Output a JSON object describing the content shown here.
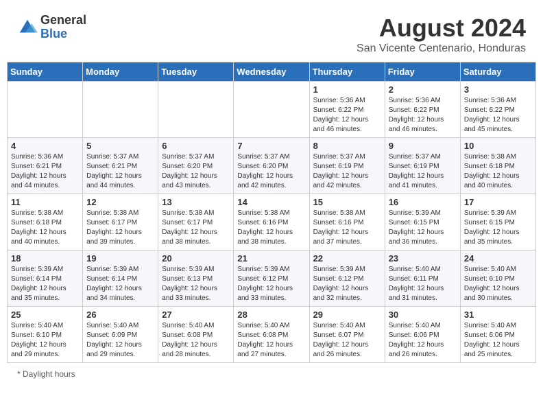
{
  "header": {
    "logo_general": "General",
    "logo_blue": "Blue",
    "month_title": "August 2024",
    "location": "San Vicente Centenario, Honduras"
  },
  "days_of_week": [
    "Sunday",
    "Monday",
    "Tuesday",
    "Wednesday",
    "Thursday",
    "Friday",
    "Saturday"
  ],
  "weeks": [
    [
      {
        "day": "",
        "info": ""
      },
      {
        "day": "",
        "info": ""
      },
      {
        "day": "",
        "info": ""
      },
      {
        "day": "",
        "info": ""
      },
      {
        "day": "1",
        "sunrise": "5:36 AM",
        "sunset": "6:22 PM",
        "daylight": "12 hours and 46 minutes."
      },
      {
        "day": "2",
        "sunrise": "5:36 AM",
        "sunset": "6:22 PM",
        "daylight": "12 hours and 46 minutes."
      },
      {
        "day": "3",
        "sunrise": "5:36 AM",
        "sunset": "6:22 PM",
        "daylight": "12 hours and 45 minutes."
      }
    ],
    [
      {
        "day": "4",
        "sunrise": "5:36 AM",
        "sunset": "6:21 PM",
        "daylight": "12 hours and 44 minutes."
      },
      {
        "day": "5",
        "sunrise": "5:37 AM",
        "sunset": "6:21 PM",
        "daylight": "12 hours and 44 minutes."
      },
      {
        "day": "6",
        "sunrise": "5:37 AM",
        "sunset": "6:20 PM",
        "daylight": "12 hours and 43 minutes."
      },
      {
        "day": "7",
        "sunrise": "5:37 AM",
        "sunset": "6:20 PM",
        "daylight": "12 hours and 42 minutes."
      },
      {
        "day": "8",
        "sunrise": "5:37 AM",
        "sunset": "6:19 PM",
        "daylight": "12 hours and 42 minutes."
      },
      {
        "day": "9",
        "sunrise": "5:37 AM",
        "sunset": "6:19 PM",
        "daylight": "12 hours and 41 minutes."
      },
      {
        "day": "10",
        "sunrise": "5:38 AM",
        "sunset": "6:18 PM",
        "daylight": "12 hours and 40 minutes."
      }
    ],
    [
      {
        "day": "11",
        "sunrise": "5:38 AM",
        "sunset": "6:18 PM",
        "daylight": "12 hours and 40 minutes."
      },
      {
        "day": "12",
        "sunrise": "5:38 AM",
        "sunset": "6:17 PM",
        "daylight": "12 hours and 39 minutes."
      },
      {
        "day": "13",
        "sunrise": "5:38 AM",
        "sunset": "6:17 PM",
        "daylight": "12 hours and 38 minutes."
      },
      {
        "day": "14",
        "sunrise": "5:38 AM",
        "sunset": "6:16 PM",
        "daylight": "12 hours and 38 minutes."
      },
      {
        "day": "15",
        "sunrise": "5:38 AM",
        "sunset": "6:16 PM",
        "daylight": "12 hours and 37 minutes."
      },
      {
        "day": "16",
        "sunrise": "5:39 AM",
        "sunset": "6:15 PM",
        "daylight": "12 hours and 36 minutes."
      },
      {
        "day": "17",
        "sunrise": "5:39 AM",
        "sunset": "6:15 PM",
        "daylight": "12 hours and 35 minutes."
      }
    ],
    [
      {
        "day": "18",
        "sunrise": "5:39 AM",
        "sunset": "6:14 PM",
        "daylight": "12 hours and 35 minutes."
      },
      {
        "day": "19",
        "sunrise": "5:39 AM",
        "sunset": "6:14 PM",
        "daylight": "12 hours and 34 minutes."
      },
      {
        "day": "20",
        "sunrise": "5:39 AM",
        "sunset": "6:13 PM",
        "daylight": "12 hours and 33 minutes."
      },
      {
        "day": "21",
        "sunrise": "5:39 AM",
        "sunset": "6:12 PM",
        "daylight": "12 hours and 33 minutes."
      },
      {
        "day": "22",
        "sunrise": "5:39 AM",
        "sunset": "6:12 PM",
        "daylight": "12 hours and 32 minutes."
      },
      {
        "day": "23",
        "sunrise": "5:40 AM",
        "sunset": "6:11 PM",
        "daylight": "12 hours and 31 minutes."
      },
      {
        "day": "24",
        "sunrise": "5:40 AM",
        "sunset": "6:10 PM",
        "daylight": "12 hours and 30 minutes."
      }
    ],
    [
      {
        "day": "25",
        "sunrise": "5:40 AM",
        "sunset": "6:10 PM",
        "daylight": "12 hours and 29 minutes."
      },
      {
        "day": "26",
        "sunrise": "5:40 AM",
        "sunset": "6:09 PM",
        "daylight": "12 hours and 29 minutes."
      },
      {
        "day": "27",
        "sunrise": "5:40 AM",
        "sunset": "6:08 PM",
        "daylight": "12 hours and 28 minutes."
      },
      {
        "day": "28",
        "sunrise": "5:40 AM",
        "sunset": "6:08 PM",
        "daylight": "12 hours and 27 minutes."
      },
      {
        "day": "29",
        "sunrise": "5:40 AM",
        "sunset": "6:07 PM",
        "daylight": "12 hours and 26 minutes."
      },
      {
        "day": "30",
        "sunrise": "5:40 AM",
        "sunset": "6:06 PM",
        "daylight": "12 hours and 26 minutes."
      },
      {
        "day": "31",
        "sunrise": "5:40 AM",
        "sunset": "6:06 PM",
        "daylight": "12 hours and 25 minutes."
      }
    ]
  ],
  "footer": "Daylight hours"
}
